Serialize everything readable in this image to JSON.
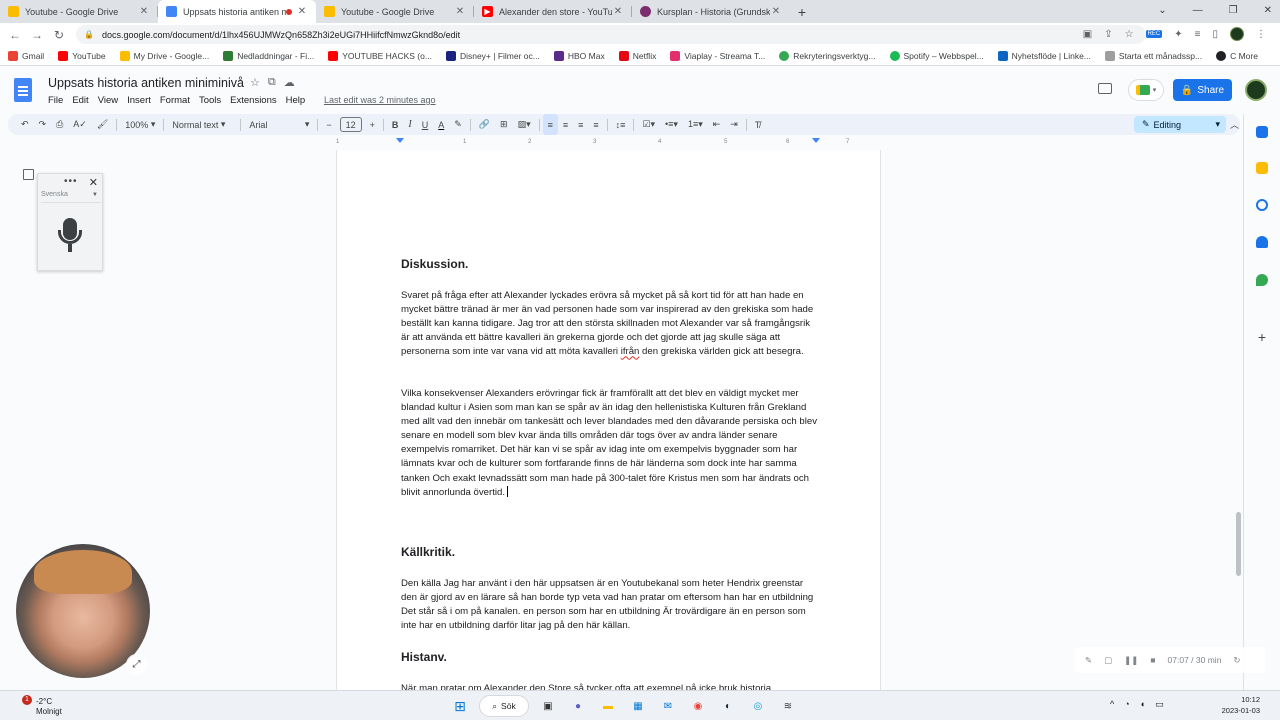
{
  "browser": {
    "tabs": [
      {
        "title": "Youtube - Google Drive",
        "favicon": "drive-icon",
        "active": false
      },
      {
        "title": "Uppsats historia antiken mini",
        "favicon": "docs-icon",
        "active": true,
        "recording": true
      },
      {
        "title": "Youtube - Google Drive",
        "favicon": "drive-icon",
        "active": false
      },
      {
        "title": "Alexander den store - YouTube",
        "favicon": "youtube-icon",
        "active": false
      },
      {
        "title": "Kursplan - Historia (Grundskolan",
        "favicon": "skolverket-icon",
        "active": false
      }
    ],
    "new_tab": "+",
    "url": "docs.google.com/document/d/1lhx456UJMWzQn658Zh3i2eUGi7HHiifcfNmwzGknd8o/edit",
    "ext_badge": "REC",
    "bookmarks": [
      {
        "label": "Gmail",
        "color": "#ea4335"
      },
      {
        "label": "YouTube",
        "color": "#ff0000"
      },
      {
        "label": "My Drive - Google...",
        "color": "#fbbc04"
      },
      {
        "label": "Nedladdningar - Fi...",
        "color": "#2e7d32"
      },
      {
        "label": "YOUTUBE HACKS (o...",
        "color": "#ff0000"
      },
      {
        "label": "Disney+ | Filmer oc...",
        "color": "#1a237e"
      },
      {
        "label": "HBO Max",
        "color": "#5b2b8c"
      },
      {
        "label": "Netflix",
        "color": "#e50914"
      },
      {
        "label": "Viaplay - Streama T...",
        "color": "#e1306c"
      },
      {
        "label": "Rekryteringsverktyg...",
        "color": "#34a853"
      },
      {
        "label": "Spotify – Webbspel...",
        "color": "#1db954"
      },
      {
        "label": "Nyhetsflöde | Linke...",
        "color": "#0a66c2"
      },
      {
        "label": "Starta ett månadssp...",
        "color": "#9e9e9e"
      },
      {
        "label": "C More",
        "color": "#202124"
      }
    ]
  },
  "docs": {
    "title": "Uppsats historia antiken miniminivå",
    "menu": [
      "File",
      "Edit",
      "View",
      "Insert",
      "Format",
      "Tools",
      "Extensions",
      "Help"
    ],
    "last_edit": "Last edit was 2 minutes ago",
    "share_label": "Share",
    "toolbar": {
      "zoom": "100%",
      "style": "Normal text",
      "font": "Arial",
      "font_size": "12",
      "mode": "Editing"
    },
    "ruler_marks": [
      "1",
      "1",
      "2",
      "3",
      "4",
      "5",
      "6",
      "7"
    ]
  },
  "voice_typing": {
    "language": "Svenska"
  },
  "document": {
    "h1": "Diskussion.",
    "p1_before": "Svaret på fråga efter att Alexander lyckades erövra så mycket på så kort tid för att han hade en mycket bättre tränad är mer än vad personen hade som var inspirerad av den grekiska som hade beställt kan kanna tidigare. Jag tror att den största skillnaden mot Alexander var så framgångsrik är att använda ett bättre kavalleri än grekerna gjorde och det gjorde att jag skulle säga att personerna som inte var vana vid att möta kavalleri",
    "p1_squiggle": "ifrån",
    "p1_after": "den grekiska världen gick att besegra.",
    "p2": "Vilka konsekvenser Alexanders erövringar fick är framförallt att det blev en väldigt mycket mer blandad kultur i Asien som man kan se spår av än idag den hellenistiska Kulturen från Grekland med allt vad den innebär om tankesätt och lever blandades med den dåvarande persiska och blev senare en modell som blev kvar ända tills områden där togs över av andra länder senare exempelvis romarriket. Det här kan vi se spår av idag inte om exempelvis byggnader som har lämnats kvar och de kulturer som fortfarande finns de här länderna som dock inte har samma tanken Och exakt levnadssätt som man hade på 300-talet före Kristus men som har ändrats och blivit annorlunda övertid.",
    "h2": "Källkritik.",
    "p3": "Den källa Jag har använt i den här uppsatsen är en Youtubekanal som heter Hendrix greenstar den är gjord av en lärare så han borde typ veta vad han pratar om eftersom han har en utbildning Det står så i om på kanalen. en person som har en utbildning Är trovärdigare än en person som inte har en utbildning darför litar jag på den här källan.",
    "h3": "Histanv.",
    "p4": "När man pratar om Alexander den Store så tycker ofta att exempel på icke bruk historia"
  },
  "recorder": {
    "time": "07:07 / 30 min"
  },
  "taskbar": {
    "weather_temp": "-2°C",
    "weather_cond": "Molnigt",
    "notification_count": "1",
    "search_label": "Sök",
    "time": "10:12",
    "date": "2023-01-03"
  }
}
